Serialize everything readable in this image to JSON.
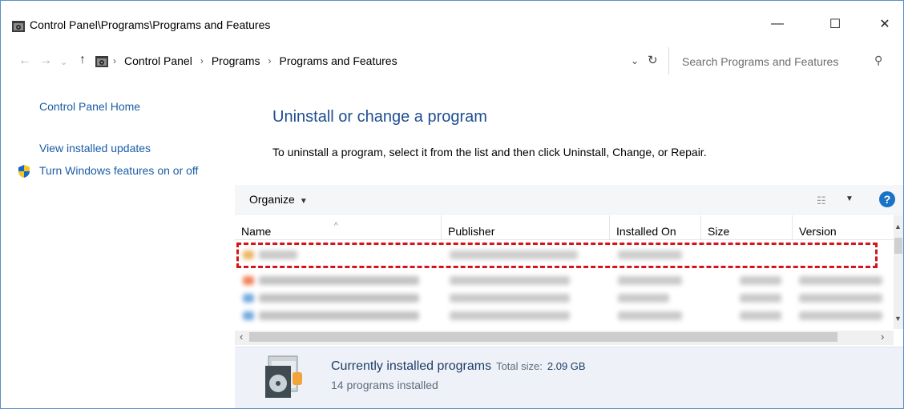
{
  "window": {
    "title": "Control Panel\\Programs\\Programs and Features",
    "controls": {
      "minimize": "—",
      "maximize": "☐",
      "close": "✕"
    }
  },
  "address_bar": {
    "crumbs": [
      "Control Panel",
      "Programs",
      "Programs and Features"
    ],
    "separator": "›",
    "search_placeholder": "Search Programs and Features"
  },
  "sidebar": {
    "links": [
      "Control Panel Home",
      "View installed updates",
      "Turn Windows features on or off"
    ]
  },
  "main": {
    "heading": "Uninstall or change a program",
    "instructions": "To uninstall a program, select it from the list and then click Uninstall, Change, or Repair."
  },
  "toolbar": {
    "organize_label": "Organize",
    "help_label": "?"
  },
  "table": {
    "columns": [
      "Name",
      "Publisher",
      "Installed On",
      "Size",
      "Version"
    ]
  },
  "details": {
    "currently_installed": "Currently installed programs",
    "total_size_label": "Total size:",
    "total_size_value": "2.09 GB",
    "count": "14 programs installed"
  },
  "colors": {
    "link": "#1a5da6",
    "heading": "#1e4e90",
    "highlight": "#d4161c",
    "details_bg": "#eef2f8"
  }
}
